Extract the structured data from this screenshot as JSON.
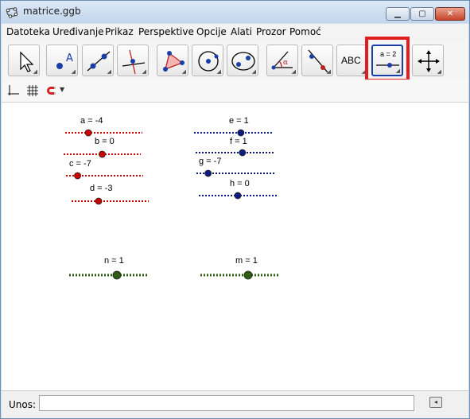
{
  "window": {
    "title": "matrice.ggb",
    "controls": [
      "minimize",
      "maximize",
      "close"
    ]
  },
  "menu": [
    "Datoteka",
    "Uređivanje",
    "Prikaz",
    "Perspektive",
    "Opcije",
    "Alati",
    "Prozor",
    "Pomoć"
  ],
  "toolbar": {
    "tools": [
      "move",
      "point",
      "line",
      "perpendicular",
      "polygon",
      "circle",
      "conic",
      "angle",
      "reflect",
      "text",
      "slider",
      "move-graphics-view"
    ],
    "text_tool_label": "ABC",
    "slider_tool_label": "a = 2",
    "highlighted_tool": "slider"
  },
  "sliders": {
    "a": {
      "label": "a = -4",
      "value": -4,
      "color": "#cc0000"
    },
    "b": {
      "label": "b = 0",
      "value": 0,
      "color": "#cc0000"
    },
    "c": {
      "label": "c = -7",
      "value": -7,
      "color": "#cc0000"
    },
    "d": {
      "label": "d = -3",
      "value": -3,
      "color": "#cc0000"
    },
    "e": {
      "label": "e = 1",
      "value": 1,
      "color": "#0d1a80"
    },
    "f": {
      "label": "f = 1",
      "value": 1,
      "color": "#0d1a80"
    },
    "g": {
      "label": "g = -7",
      "value": -7,
      "color": "#0d1a80"
    },
    "h": {
      "label": "h = 0",
      "value": 0,
      "color": "#0d1a80"
    },
    "n": {
      "label": "n = 1",
      "value": 1,
      "color": "#2e5e10"
    },
    "m": {
      "label": "m = 1",
      "value": 1,
      "color": "#2e5e10"
    }
  },
  "input_bar": {
    "label": "Unos:",
    "value": ""
  }
}
